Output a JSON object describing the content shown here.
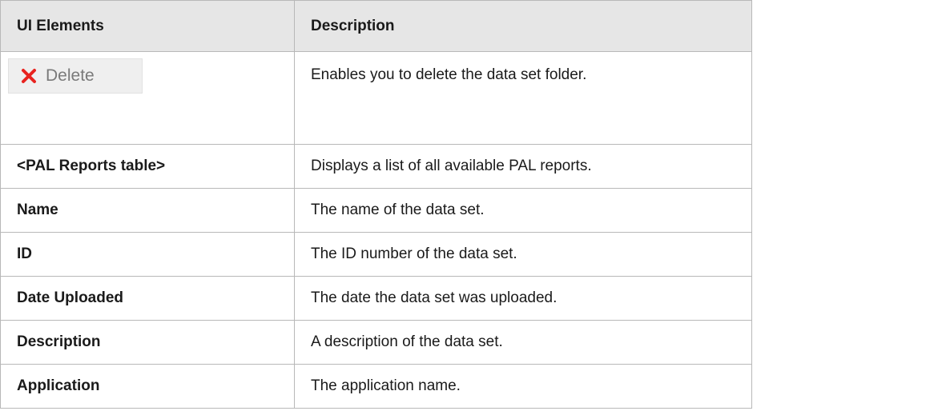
{
  "table": {
    "headers": {
      "ui_elements": "UI Elements",
      "description": "Description"
    },
    "delete_row": {
      "button_label": "Delete",
      "icon": "close-icon",
      "icon_color": "#e8231f",
      "description": "Enables you to delete the data set folder."
    },
    "rows": [
      {
        "element": "<PAL Reports table>",
        "description": "Displays a list of all available PAL reports."
      },
      {
        "element": "Name",
        "description": "The name of the data set."
      },
      {
        "element": "ID",
        "description": "The ID number of the data set."
      },
      {
        "element": "Date Uploaded",
        "description": "The date the data set was uploaded."
      },
      {
        "element": "Description",
        "description": "A description of the data set."
      },
      {
        "element": "Application",
        "description": "The application name."
      }
    ]
  }
}
